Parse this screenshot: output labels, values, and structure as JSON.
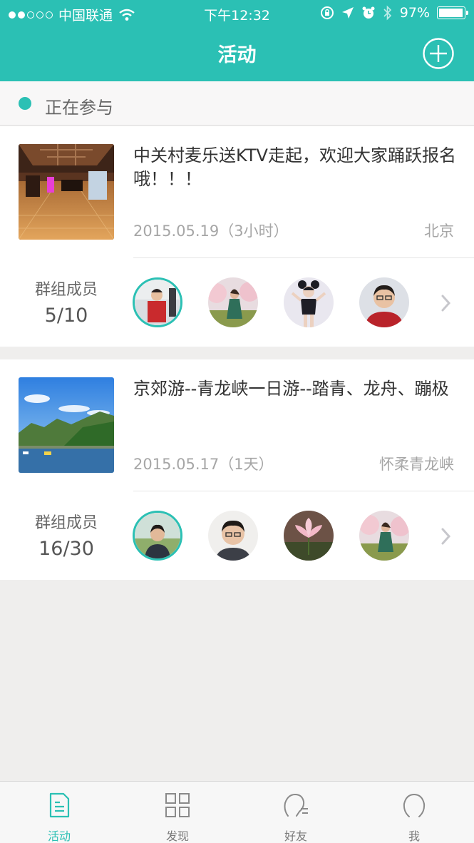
{
  "status": {
    "carrier": "中国联通",
    "time": "下午12:32",
    "battery": "97%",
    "battery_level": 0.97
  },
  "header": {
    "title": "活动"
  },
  "section": {
    "label": "正在参与"
  },
  "activities": [
    {
      "title": "中关村麦乐送KTV走起，欢迎大家踊跃报名哦！！！",
      "date": "2015.05.19（3小时）",
      "location": "北京",
      "members_label": "群组成员",
      "members_count": "5/10"
    },
    {
      "title": "京郊游--青龙峡一日游--踏青、龙舟、蹦极",
      "date": "2015.05.17（1天）",
      "location": "怀柔青龙峡",
      "members_label": "群组成员",
      "members_count": "16/30"
    }
  ],
  "tabs": [
    {
      "label": "活动",
      "icon": "document-icon",
      "active": true
    },
    {
      "label": "发现",
      "icon": "grid-icon",
      "active": false
    },
    {
      "label": "好友",
      "icon": "friends-icon",
      "active": false
    },
    {
      "label": "我",
      "icon": "user-icon",
      "active": false
    }
  ],
  "colors": {
    "accent": "#2bc0b4",
    "background": "#efeeed",
    "secondary_text": "#a6a6a6"
  }
}
